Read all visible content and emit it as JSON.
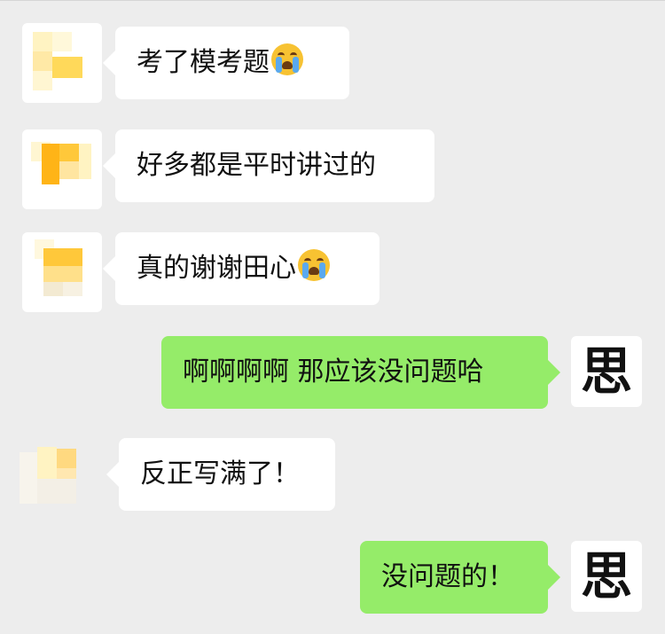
{
  "chat": {
    "messages": [
      {
        "side": "left",
        "text": "考了模考题",
        "emoji": "loudly-crying-face-icon"
      },
      {
        "side": "left",
        "text": "好多都是平时讲过的",
        "emoji": ""
      },
      {
        "side": "left",
        "text": "真的谢谢田心",
        "emoji": "loudly-crying-face-icon"
      },
      {
        "side": "right",
        "text": "啊啊啊啊 那应该没问题哈",
        "emoji": ""
      },
      {
        "side": "left",
        "text": "反正写满了！",
        "emoji": ""
      },
      {
        "side": "right",
        "text": "没问题的！",
        "emoji": ""
      }
    ],
    "self_avatar_glyph": "思"
  },
  "colors": {
    "background": "#ededed",
    "incoming_bubble": "#ffffff",
    "outgoing_bubble": "#95ec69",
    "avatar_mosaic": [
      "#ffc83a",
      "#ffe08a",
      "#fff3c2",
      "#ffb417",
      "#f5f0dc"
    ]
  }
}
